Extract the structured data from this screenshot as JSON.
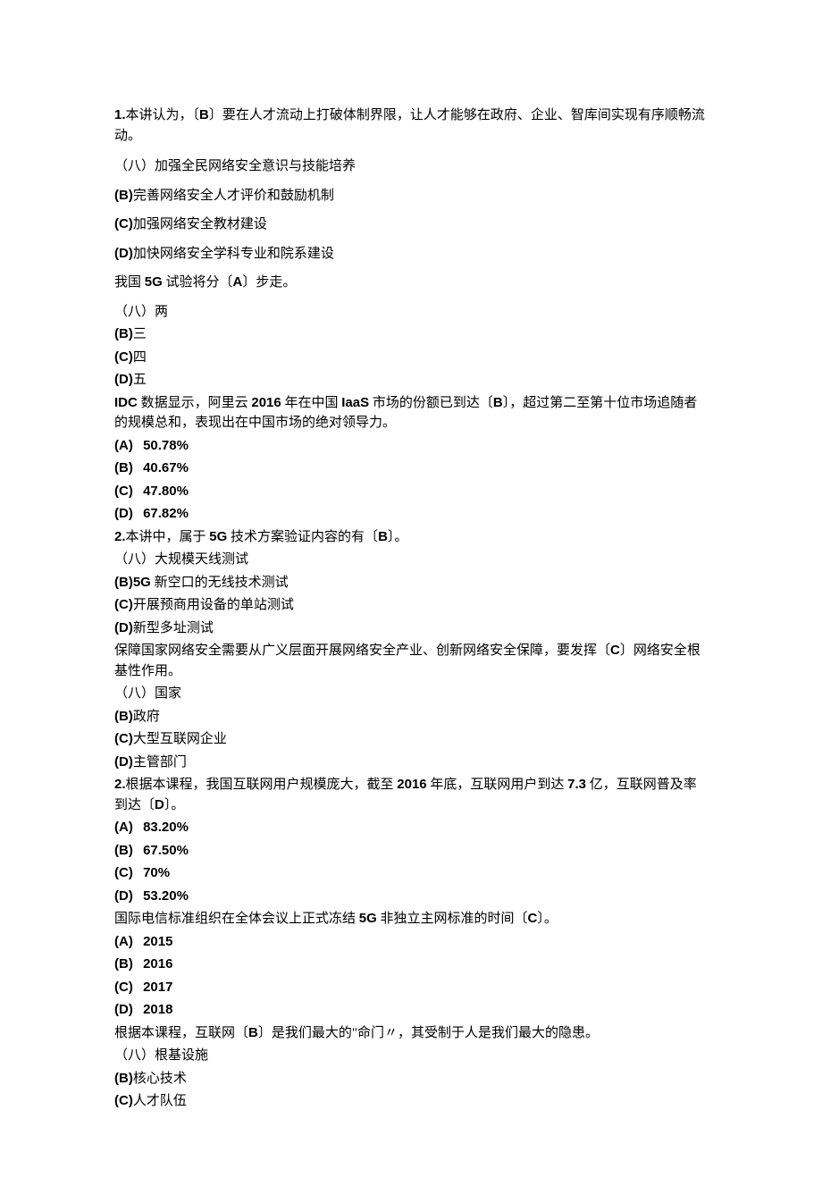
{
  "q1": {
    "num": "1.",
    "pre": "本讲认为，〔",
    "ans": "B",
    "post": "〕要在人才流动上打破体制界限，让人才能够在政府、企业、智库间实现有序顺畅流动。",
    "a_pre": "（八）",
    "a": "加强全民网络安全意识与技能培养",
    "b_lbl": "(B)",
    "b": "完善网络安全人才评价和鼓励机制",
    "c_lbl": "(C)",
    "c": "加强网络安全教材建设",
    "d_lbl": "(D)",
    "d": "加快网络安全学科专业和院系建设"
  },
  "q2": {
    "pre": "我国 ",
    "mid1": "5G",
    "mid2": " 试验将分〔",
    "ans": "A",
    "post": "〕步走。",
    "a_pre": "（八）",
    "a": "两",
    "b_lbl": "(B)",
    "b": "三",
    "c_lbl": "(C)",
    "c": "四",
    "d_lbl": "(D)",
    "d": "五"
  },
  "q3": {
    "pre1": "IDC",
    "pre2": " 数据显示，阿里云 ",
    "yr": "2016",
    "mid": " 年在中国 ",
    "iaas": "IaaS",
    "mid2": " 市场的份额已到达〔",
    "ans": "B",
    "post": "〕，超过第二至第十位市场追随者的规模总和，表现出在中国市场的绝对领导力。",
    "a_lbl": "(A)",
    "a": "50.78%",
    "b_lbl": "(B)",
    "b": "40.67%",
    "c_lbl": "(C)",
    "c": "47.80%",
    "d_lbl": "(D)",
    "d": "67.82%"
  },
  "q4": {
    "num": "2.",
    "pre": "本讲中，属于 ",
    "mid1": "5G",
    "mid2": " 技术方案验证内容的有〔",
    "ans": "B",
    "post": "〕。",
    "a_pre": "（八）",
    "a": "大规模天线测试",
    "b_lbl": "(B)5G",
    "b": " 新空口的无线技术测试",
    "c_lbl": "(C)",
    "c": "开展预商用设备的单站测试",
    "d_lbl": "(D)",
    "d": "新型多址测试"
  },
  "q5": {
    "pre": "保障国家网络安全需要从广义层面开展网络安全产业、创新网络安全保障，要发挥〔",
    "ans": "C",
    "post": "〕网络安全根基性作用。",
    "a_pre": "（八）",
    "a": "国家",
    "b_lbl": "(B)",
    "b": "政府",
    "c_lbl": "(C)",
    "c": "大型互联网企业",
    "d_lbl": "(D)",
    "d": "主管部门"
  },
  "q6": {
    "num": "2.",
    "pre": "根据本课程，我国互联网用户规模庞大，截至 ",
    "yr": "2016",
    "mid1": " 年底，互联网用户到达 ",
    "val": "7.3",
    "mid2": " 亿，互联网普及率到达〔",
    "ans": "D",
    "post": "〕。",
    "a_lbl": "(A)",
    "a": "83.20%",
    "b_lbl": "(B)",
    "b": "67.50%",
    "c_lbl": "(C)",
    "c": "70%",
    "d_lbl": "(D)",
    "d": "53.20%"
  },
  "q7": {
    "pre": "国际电信标准组织在全体会议上正式冻结 ",
    "mid1": "5G",
    "mid2": " 非独立主网标准的时间〔",
    "ans": "C",
    "post": "〕。",
    "a_lbl": "(A)",
    "a": "2015",
    "b_lbl": "(B)",
    "b": "2016",
    "c_lbl": "(C)",
    "c": "2017",
    "d_lbl": "(D)",
    "d": "2018"
  },
  "q8": {
    "pre": "根据本课程，互联网〔",
    "ans": "B",
    "post": "〕是我们最大的\"命门〃，其受制于人是我们最大的隐患。",
    "a_pre": "（八）",
    "a": "根基设施",
    "b_lbl": "(B)",
    "b": "核心技术",
    "c_lbl": "(C)",
    "c": "人才队伍"
  }
}
